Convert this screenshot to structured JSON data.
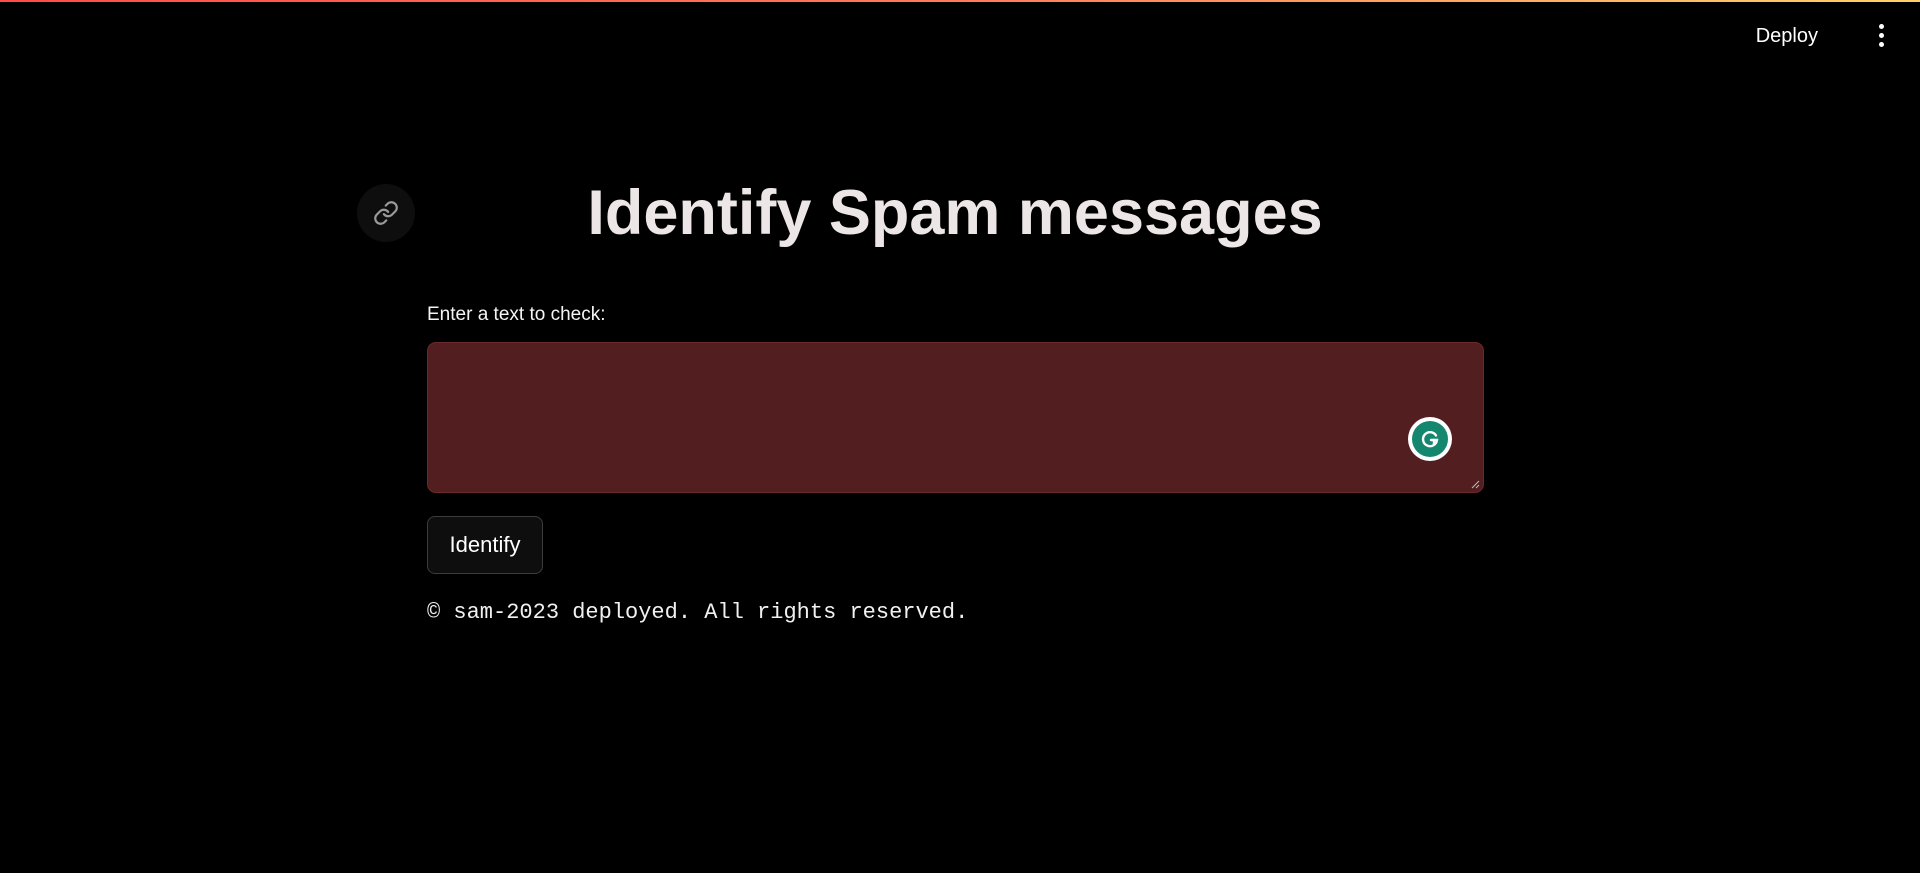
{
  "header": {
    "deploy_label": "Deploy",
    "menu_icon": "vertical-ellipsis-icon",
    "accent_gradient": [
      "#ff4b4b",
      "#ffd16a"
    ]
  },
  "main": {
    "anchor_icon": "link-icon",
    "title": "Identify Spam messages",
    "input_label": "Enter a text to check:",
    "input_value": "",
    "input_background": "#521e1f",
    "grammarly_icon": "grammarly-icon",
    "submit_label": "Identify",
    "footer": "© sam-2023 deployed. All rights reserved."
  }
}
